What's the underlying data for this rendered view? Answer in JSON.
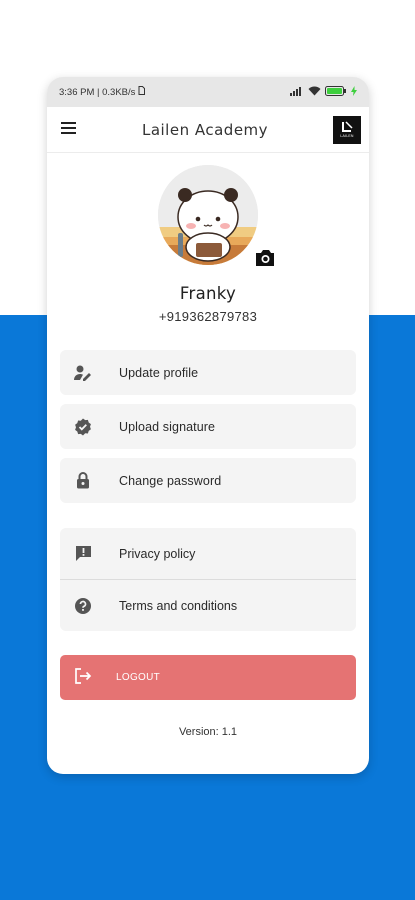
{
  "status_bar": {
    "time": "3:36 PM | 0.3KB/s",
    "battery_icon": "battery-icon",
    "colors": {
      "battery": "#3ecf3e"
    }
  },
  "app_bar": {
    "title": "Lailen Academy",
    "menu_icon": "hamburger-menu-icon",
    "logo_text": "LAILEN"
  },
  "profile": {
    "name": "Franky",
    "phone": "+919362879783",
    "camera_icon": "camera-icon"
  },
  "menu": {
    "items": [
      {
        "label": "Update profile",
        "icon": "edit-person-icon"
      },
      {
        "label": "Upload signature",
        "icon": "verified-badge-icon"
      },
      {
        "label": "Change password",
        "icon": "lock-icon"
      }
    ],
    "info_items": [
      {
        "label": "Privacy policy",
        "icon": "report-icon"
      },
      {
        "label": "Terms and conditions",
        "icon": "help-icon"
      }
    ]
  },
  "logout": {
    "label": "LOGOUT",
    "icon": "logout-icon",
    "color": "#e57373"
  },
  "version": "Version: 1.1",
  "colors": {
    "background_blue": "#0a78d8",
    "card_bg": "#f4f4f4"
  }
}
